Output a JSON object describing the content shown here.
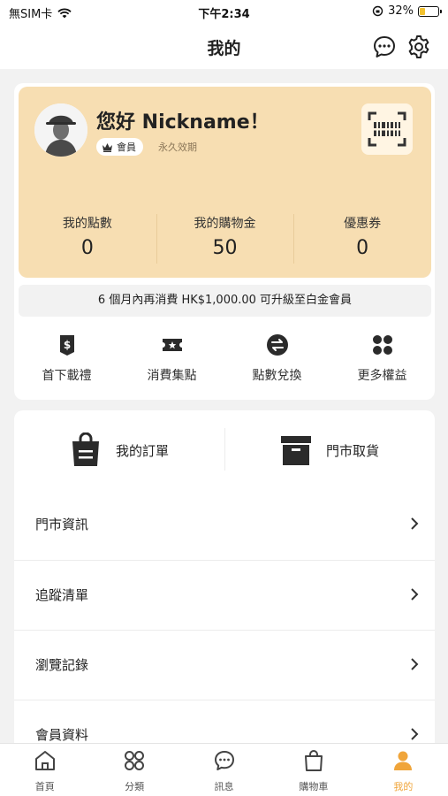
{
  "status_bar": {
    "carrier": "無SIM卡",
    "time": "下午2:34",
    "battery_text": "32%",
    "battery_level": 0.32
  },
  "nav": {
    "title": "我的",
    "icons": [
      "chat-bubble-icon",
      "gear-icon"
    ]
  },
  "member_card": {
    "greeting": "您好 Nickname！",
    "tier": "會員",
    "validity": "永久效期",
    "qr_icon": "barcode-scan-icon",
    "stats": [
      {
        "label": "我的點數",
        "value": "0"
      },
      {
        "label": "我的購物金",
        "value": "50"
      },
      {
        "label": "優惠券",
        "value": "0"
      }
    ],
    "accent_color": "#f7deb2"
  },
  "upgrade_text": "6 個月內再消費 HK$1,000.00 可升級至白金會員",
  "benefits": [
    {
      "label": "首下載禮",
      "icon": "dollar-tag-icon"
    },
    {
      "label": "消費集點",
      "icon": "star-ticket-icon"
    },
    {
      "label": "點數兌換",
      "icon": "exchange-icon"
    },
    {
      "label": "更多權益",
      "icon": "grid-more-icon"
    }
  ],
  "orders": [
    {
      "label": "我的訂單",
      "icon": "shopping-bag-icon"
    },
    {
      "label": "門市取貨",
      "icon": "store-box-icon"
    }
  ],
  "menu": [
    {
      "label": "門市資訊"
    },
    {
      "label": "追蹤清單"
    },
    {
      "label": "瀏覽記錄"
    },
    {
      "label": "會員資料"
    }
  ],
  "tab_bar": {
    "active_color": "#f0a53a",
    "tabs": [
      {
        "label": "首頁",
        "icon": "home-icon"
      },
      {
        "label": "分類",
        "icon": "category-icon"
      },
      {
        "label": "訊息",
        "icon": "message-icon"
      },
      {
        "label": "購物車",
        "icon": "cart-bag-icon"
      },
      {
        "label": "我的",
        "icon": "profile-icon",
        "active": true
      }
    ]
  }
}
